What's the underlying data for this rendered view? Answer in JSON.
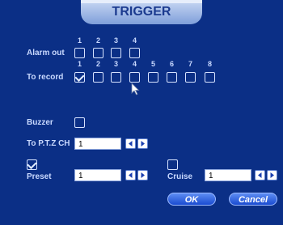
{
  "dialog": {
    "title": "TRIGGER"
  },
  "alarm_out": {
    "label": "Alarm out",
    "channels": [
      "1",
      "2",
      "3",
      "4"
    ],
    "checked": [
      false,
      false,
      false,
      false
    ]
  },
  "to_record": {
    "label": "To record",
    "channels": [
      "1",
      "2",
      "3",
      "4",
      "5",
      "6",
      "7",
      "8"
    ],
    "checked": [
      true,
      false,
      false,
      false,
      false,
      false,
      false,
      false
    ]
  },
  "buzzer": {
    "label": "Buzzer",
    "checked": false
  },
  "ptz": {
    "label": "To P.T.Z CH",
    "value": "1"
  },
  "preset": {
    "label": "Preset",
    "checked": true,
    "value": "1"
  },
  "cruise": {
    "label": "Cruise",
    "checked": false,
    "value": "1"
  },
  "buttons": {
    "ok": "OK",
    "cancel": "Cancel"
  },
  "icons": {
    "prev": "left-arrow-icon",
    "next": "right-arrow-icon",
    "cursor": "mouse-pointer-icon"
  }
}
